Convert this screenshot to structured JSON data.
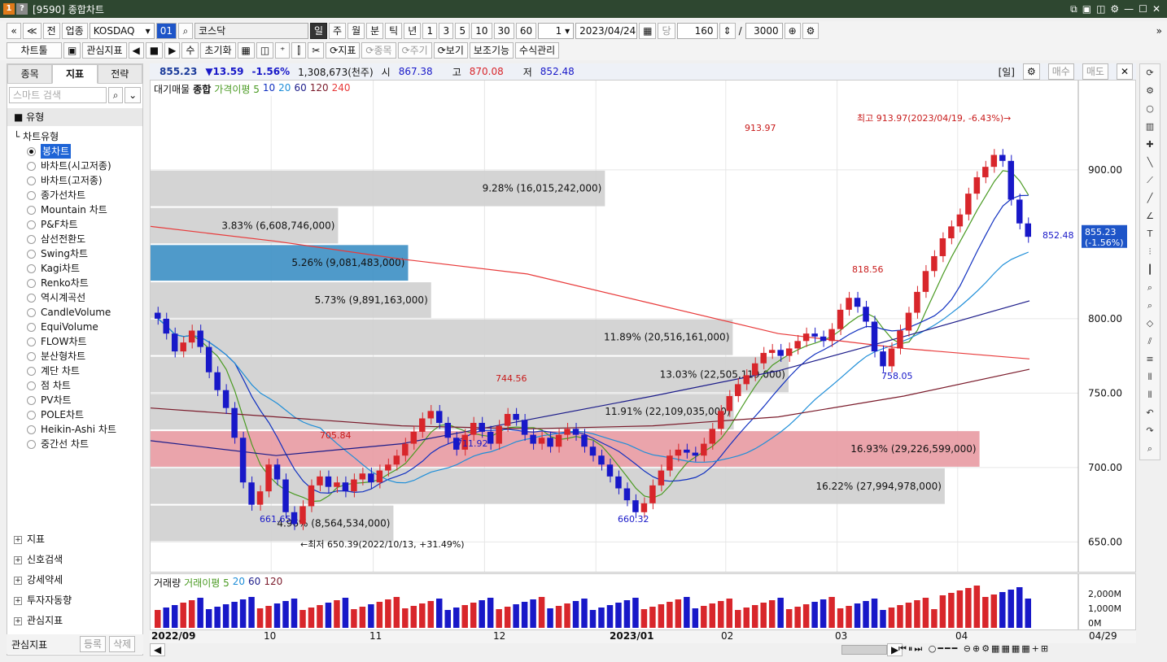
{
  "window": {
    "badge1": "1",
    "badge2": "?",
    "title": "[9590] 종합차트",
    "controls": [
      "⧉",
      "▣",
      "◫",
      "⚙",
      "—",
      "☐",
      "✕"
    ]
  },
  "toolbar1": {
    "nav": [
      "«",
      "≪"
    ],
    "btn_jeon": "전",
    "btn_upjong": "업종",
    "market_select": "KOSDAQ",
    "code_btn": "01",
    "market_name": "코스닥",
    "periods": [
      "일",
      "주",
      "월",
      "분",
      "틱",
      "년"
    ],
    "intervals": [
      "1",
      "3",
      "5",
      "10",
      "30",
      "60"
    ],
    "count_value": "1",
    "date": "2023/04/24",
    "dang": "당",
    "bars": "160",
    "slash": "/",
    "total": "3000",
    "expand": "»"
  },
  "toolbar2": {
    "chart_tool": "차트툴",
    "watch_indicator": "관심지표",
    "play": [
      "◀",
      "■",
      "▶"
    ],
    "su": "수",
    "reset": "초기화",
    "indicator_btn": "지표",
    "item_btn": "종목",
    "period_btn": "주기",
    "view_btn": "보기",
    "aux": "보조기능",
    "formula": "수식관리"
  },
  "left_panel": {
    "tabs": [
      "종목",
      "지표",
      "전략"
    ],
    "search_placeholder": "스마트 검색",
    "section": "유형",
    "tree_root": "차트유형",
    "chart_types": [
      "봉차트",
      "바차트(시고저종)",
      "바차트(고저종)",
      "종가선차트",
      "Mountain 차트",
      "P&F차트",
      "삼선전환도",
      "Swing차트",
      "Kagi차트",
      "Renko차트",
      "역시계곡선",
      "CandleVolume",
      "EquiVolume",
      "FLOW차트",
      "분산형차트",
      "계단 차트",
      "점 차트",
      "PV차트",
      "POLE차트",
      "Heikin-Ashi 차트",
      "중간선 차트"
    ],
    "groups": [
      "지표",
      "신호검색",
      "강세약세",
      "투자자동향",
      "관심지표"
    ],
    "bottom": {
      "label": "관심지표",
      "register": "등록",
      "delete": "삭제"
    }
  },
  "info_bar": {
    "price": "855.23",
    "change": "▼13.59",
    "pct": "-1.56%",
    "volume": "1,308,673(천주)",
    "open_label": "시",
    "open": "867.38",
    "high_label": "고",
    "high": "870.08",
    "low_label": "저",
    "low": "852.48",
    "period_tag": "[일]",
    "buy": "매수",
    "sell": "매도"
  },
  "colors": {
    "up": "#d8262b",
    "down": "#1818c8",
    "ma5": "#4a9a22",
    "ma10": "#1030c0",
    "ma20": "#1e8ed8",
    "ma60": "#1c1c8a",
    "ma120": "#7a1a2a",
    "ma240": "#e83a3a",
    "profile": "#cfcfcf",
    "profile_blue": "#3c8fc4",
    "profile_red": "#e89aa2"
  },
  "legend": {
    "items": [
      "대기매물",
      "종합",
      "가격이평 5",
      "10",
      "20",
      "60",
      "120",
      "240"
    ]
  },
  "chart_data": {
    "type": "candlestick",
    "x_start": "2022/09",
    "x_ticks": [
      "2022/09",
      "10",
      "11",
      "12",
      "2023/01",
      "02",
      "03",
      "04"
    ],
    "last_label": "04/29",
    "ylim": [
      630,
      960
    ],
    "y_ticks": [
      650,
      700,
      750,
      800,
      900
    ],
    "y_tick_labels": [
      "650.00",
      "700.00",
      "750.00",
      "800.00",
      "900.00"
    ],
    "current": {
      "line1": "855.23",
      "line2": "(-1.56%)",
      "value": 855.23
    },
    "annotations": [
      {
        "text": "최고 913.97(2023/04/19, -6.43%)→",
        "pos": "high"
      },
      {
        "text": "913.97",
        "price": 913.97
      },
      {
        "text": "818.56",
        "price": 818.56
      },
      {
        "text": "758.05",
        "price": 758.05
      },
      {
        "text": "744.56",
        "price": 744.56
      },
      {
        "text": "711.92",
        "price": 711.92
      },
      {
        "text": "705.84",
        "price": 705.84
      },
      {
        "text": "661.65",
        "price": 661.65
      },
      {
        "text": "660.32",
        "price": 660.32
      },
      {
        "text": "852.48",
        "price": 852.48
      },
      {
        "text": "←최저 650.39(2022/10/13, +31.49%)",
        "pos": "low"
      }
    ],
    "volume_profile": [
      {
        "low": 650,
        "high": 675,
        "pct": 4.96,
        "label": "4.96% (8,564,534,000)"
      },
      {
        "low": 675,
        "high": 700,
        "pct": 16.22,
        "label": "16.22% (27,994,978,000)"
      },
      {
        "low": 700,
        "high": 725,
        "pct": 16.93,
        "label": "16.93% (29,226,599,000)",
        "hl": "red"
      },
      {
        "low": 725,
        "high": 750,
        "pct": 11.91,
        "label": "11.91% (22,109,035,000)"
      },
      {
        "low": 750,
        "high": 775,
        "pct": 13.03,
        "label": "13.03% (22,505,119,000)"
      },
      {
        "low": 775,
        "high": 800,
        "pct": 11.89,
        "label": "11.89% (20,516,161,000)"
      },
      {
        "low": 800,
        "high": 825,
        "pct": 5.73,
        "label": "5.73% (9,891,163,000)"
      },
      {
        "low": 825,
        "high": 850,
        "pct": 5.26,
        "label": "5.26% (9,081,483,000)",
        "hl": "blue"
      },
      {
        "low": 850,
        "high": 875,
        "pct": 3.83,
        "label": "3.83% (6,608,746,000)"
      },
      {
        "low": 875,
        "high": 900,
        "pct": 9.28,
        "label": "9.28% (16,015,242,000)"
      }
    ],
    "close_series": [
      800,
      790,
      778,
      784,
      792,
      781,
      764,
      752,
      740,
      720,
      690,
      675,
      684,
      702,
      692,
      670,
      662,
      674,
      688,
      694,
      687,
      690,
      684,
      692,
      696,
      690,
      698,
      702,
      708,
      716,
      724,
      733,
      738,
      730,
      720,
      712,
      722,
      730,
      724,
      716,
      728,
      736,
      732,
      722,
      716,
      720,
      714,
      722,
      726,
      722,
      714,
      708,
      702,
      694,
      686,
      678,
      670,
      676,
      688,
      698,
      708,
      712,
      710,
      708,
      716,
      726,
      738,
      748,
      756,
      762,
      770,
      777,
      779,
      775,
      780,
      785,
      790,
      788,
      785,
      793,
      806,
      814,
      808,
      798,
      778,
      768,
      780,
      792,
      804,
      818,
      832,
      842,
      854,
      862,
      870,
      884,
      895,
      902,
      910,
      906,
      880,
      864,
      855
    ],
    "ma_series": {
      "ma60": [
        718,
        708,
        716,
        732,
        748,
        765,
        788,
        812
      ],
      "ma120": [
        740,
        734,
        728,
        726,
        728,
        734,
        748,
        766
      ],
      "ma240": [
        862,
        852,
        840,
        830,
        810,
        790,
        780,
        773
      ]
    },
    "volume": {
      "legend": [
        "거래량",
        "거래이평 5",
        "20",
        "60",
        "120"
      ],
      "y_tick_labels": [
        "2,000M",
        "1,000M",
        "0M"
      ]
    }
  }
}
